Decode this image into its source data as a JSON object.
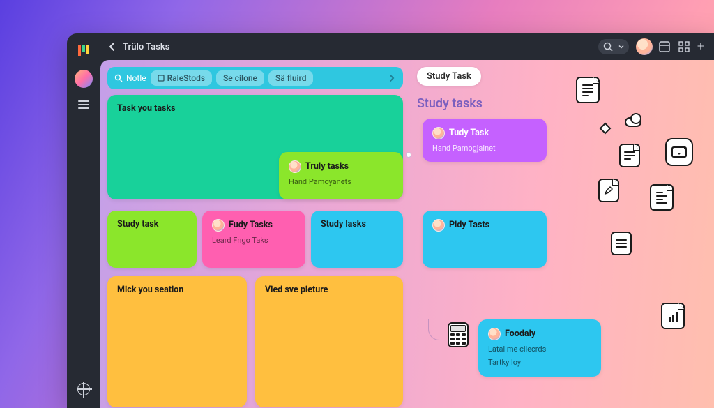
{
  "topbar": {
    "title": "Trülo Tasks",
    "search_placeholder": "Search",
    "plus_label": "+"
  },
  "filter": {
    "note": "Notle",
    "chips": [
      "RaleStods",
      "Se cilone",
      "Sä fluird"
    ]
  },
  "left_cards": {
    "big_green": {
      "title": "Task you tasks"
    },
    "lime_over": {
      "title": "Truly tasks",
      "sub": "Hand Pamoyanets"
    },
    "lime_small": {
      "title": "Study task"
    },
    "pink": {
      "title": "Fudy Tasks",
      "sub": "Leard Fngo Taks"
    },
    "cyan": {
      "title": "Study lasks"
    },
    "orange_l": {
      "title": "Mick you seation"
    },
    "orange_r": {
      "title": "Vied sve pieture"
    }
  },
  "right": {
    "tab": "Study Task",
    "heading": "Study tasks",
    "purple": {
      "title": "Tudy Task",
      "sub": "Hand Pamogjainet"
    },
    "cyan2": {
      "title": "Pldy Tasts"
    },
    "blue": {
      "title": "Foodaly",
      "sub1": "Latal me cllecrds",
      "sub2": "Tartky loy"
    }
  },
  "icons": {
    "doc": "document-icon",
    "list": "list-icon",
    "pen": "pen-document-icon",
    "chart": "chart-document-icon",
    "calc": "calculator-icon",
    "mail": "mail-icon",
    "cloud": "cloud-icon",
    "diamond": "diamond-icon"
  }
}
